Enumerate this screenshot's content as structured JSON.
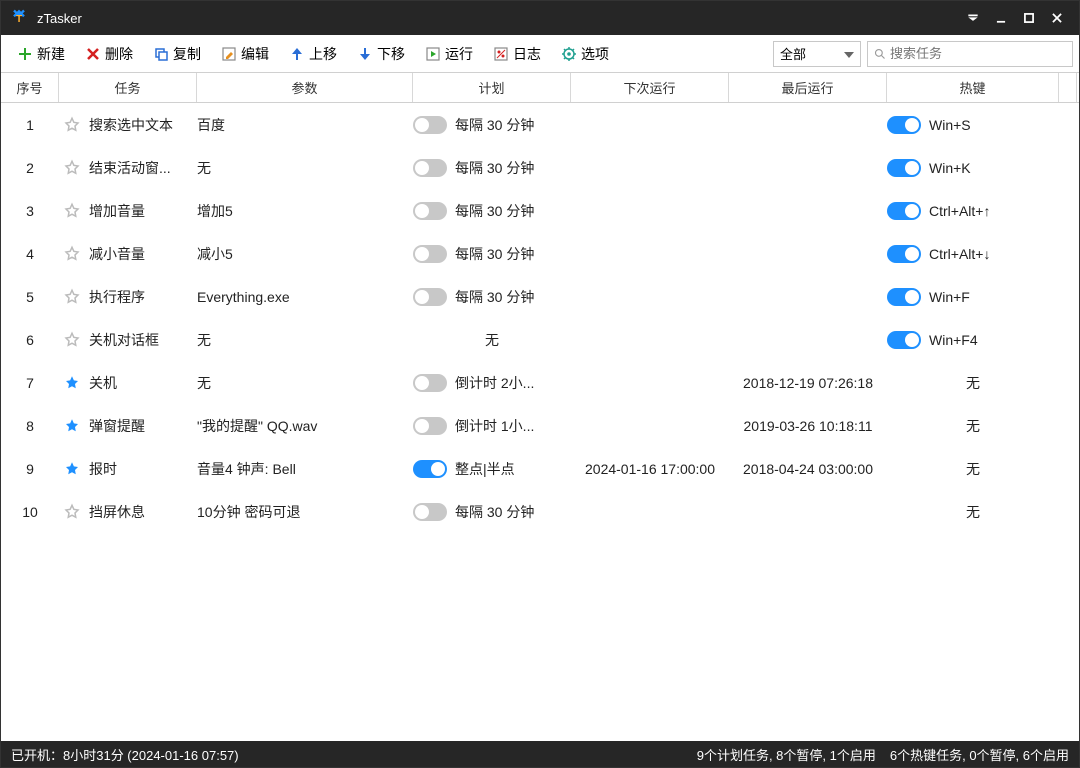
{
  "app": {
    "title": "zTasker"
  },
  "toolbar": {
    "new": "新建",
    "delete": "删除",
    "copy": "复制",
    "edit": "编辑",
    "up": "上移",
    "down": "下移",
    "run": "运行",
    "log": "日志",
    "options": "选项"
  },
  "filter": {
    "selected": "全部"
  },
  "search": {
    "placeholder": "搜索任务"
  },
  "columns": {
    "idx": "序号",
    "task": "任务",
    "param": "参数",
    "plan": "计划",
    "next": "下次运行",
    "last": "最后运行",
    "hotkey": "热键"
  },
  "rows": [
    {
      "idx": "1",
      "starred": false,
      "task": "搜索选中文本",
      "param": "百度",
      "planOn": false,
      "plan": "每隔 30 分钟",
      "next": "",
      "last": "",
      "hotkeyOn": true,
      "hotkey": "Win+S"
    },
    {
      "idx": "2",
      "starred": false,
      "task": "结束活动窗...",
      "param": "无",
      "planOn": false,
      "plan": "每隔 30 分钟",
      "next": "",
      "last": "",
      "hotkeyOn": true,
      "hotkey": "Win+K"
    },
    {
      "idx": "3",
      "starred": false,
      "task": "增加音量",
      "param": "增加5",
      "planOn": false,
      "plan": "每隔 30 分钟",
      "next": "",
      "last": "",
      "hotkeyOn": true,
      "hotkey": "Ctrl+Alt+↑"
    },
    {
      "idx": "4",
      "starred": false,
      "task": "减小音量",
      "param": "减小5",
      "planOn": false,
      "plan": "每隔 30 分钟",
      "next": "",
      "last": "",
      "hotkeyOn": true,
      "hotkey": "Ctrl+Alt+↓"
    },
    {
      "idx": "5",
      "starred": false,
      "task": "执行程序",
      "param": "Everything.exe",
      "planOn": false,
      "plan": "每隔 30 分钟",
      "next": "",
      "last": "",
      "hotkeyOn": true,
      "hotkey": "Win+F"
    },
    {
      "idx": "6",
      "starred": false,
      "task": "关机对话框",
      "param": "无",
      "planOn": false,
      "plan": "无",
      "next": "",
      "last": "",
      "hotkeyOn": true,
      "hotkey": "Win+F4",
      "planCentered": true,
      "noPlanToggle": true
    },
    {
      "idx": "7",
      "starred": true,
      "task": "关机",
      "param": "无",
      "planOn": false,
      "plan": "倒计时 2小...",
      "next": "",
      "last": "2018-12-19 07:26:18",
      "hotkeyOn": false,
      "hotkey": "无",
      "hotkeyCentered": true
    },
    {
      "idx": "8",
      "starred": true,
      "task": "弹窗提醒",
      "param": "\"我的提醒\" QQ.wav",
      "planOn": false,
      "plan": "倒计时 1小...",
      "next": "",
      "last": "2019-03-26 10:18:11",
      "hotkeyOn": false,
      "hotkey": "无",
      "hotkeyCentered": true
    },
    {
      "idx": "9",
      "starred": true,
      "task": "报时",
      "param": "音量4 钟声: Bell",
      "planOn": true,
      "plan": "整点|半点",
      "next": "2024-01-16 17:00:00",
      "last": "2018-04-24 03:00:00",
      "hotkeyOn": false,
      "hotkey": "无",
      "hotkeyCentered": true
    },
    {
      "idx": "10",
      "starred": false,
      "task": "挡屏休息",
      "param": "10分钟 密码可退",
      "planOn": false,
      "plan": "每隔 30 分钟",
      "next": "",
      "last": "",
      "hotkeyOn": false,
      "hotkey": "无",
      "hotkeyCentered": true
    }
  ],
  "status": {
    "uptime": "已开机：8小时31分 (2024-01-16 07:57)",
    "plan_summary": "9个计划任务, 8个暂停, 1个启用",
    "hotkey_summary": "6个热键任务, 0个暂停, 6个启用"
  }
}
